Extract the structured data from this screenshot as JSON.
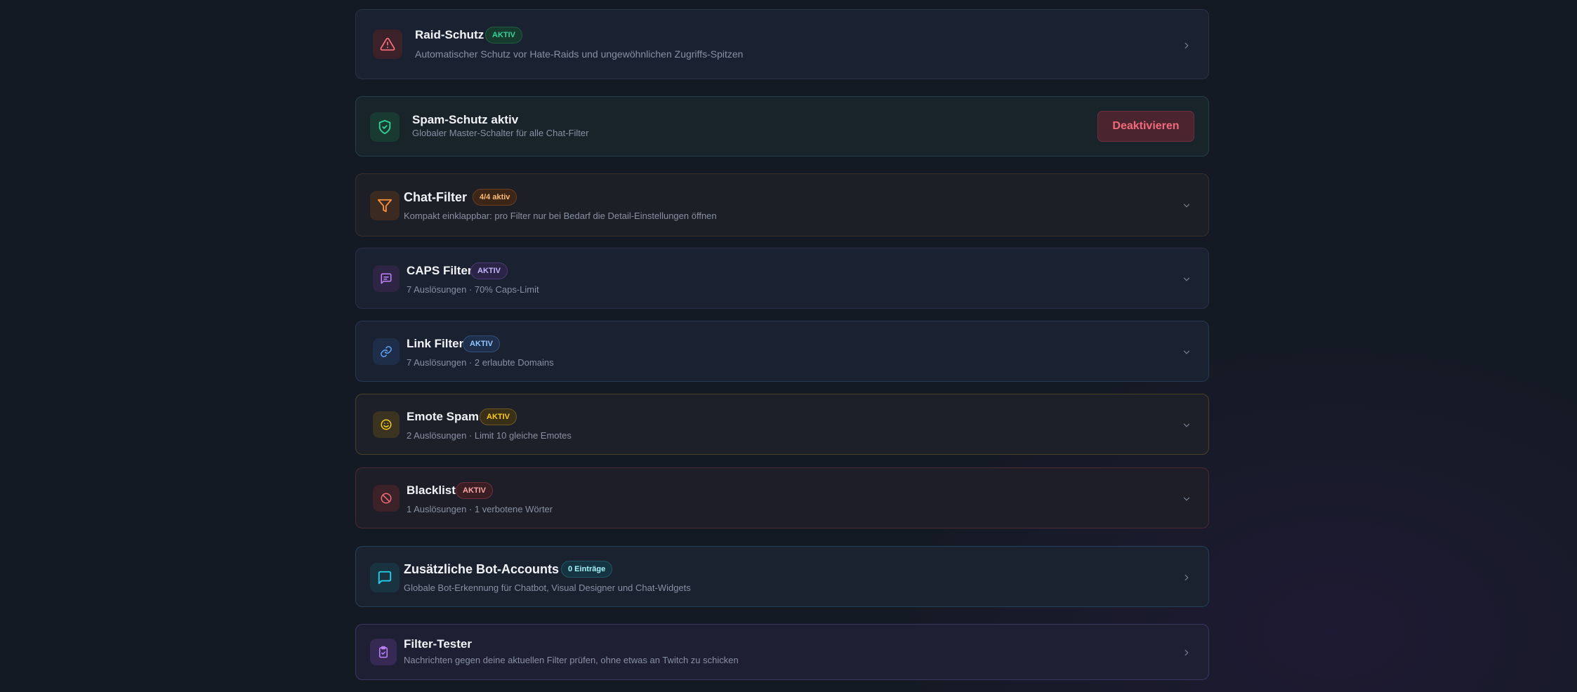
{
  "colors": {
    "red": "#f06a79",
    "green": "#34d399",
    "orange": "#fb923c",
    "purple": "#c084fc",
    "blue": "#60a5fa",
    "yellow": "#facc15",
    "cyan": "#22d3ee"
  },
  "raid": {
    "title": "Raid-Schutz",
    "badge": "AKTIV",
    "subtitle": "Automatischer Schutz vor Hate-Raids und ungewöhnlichen Zugriffs-Spitzen",
    "icon": "warning-triangle-icon"
  },
  "spam": {
    "title": "Spam-Schutz aktiv",
    "subtitle": "Globaler Master-Schalter für alle Chat-Filter",
    "button": "Deaktivieren",
    "icon": "shield-check-icon"
  },
  "chatfilter": {
    "title": "Chat-Filter",
    "badge": "4/4 aktiv",
    "subtitle": "Kompakt einklappbar: pro Filter nur bei Bedarf die Detail-Einstellungen öffnen",
    "icon": "filter-icon"
  },
  "filters": [
    {
      "title": "CAPS Filter",
      "badge": "AKTIV",
      "subtitle": "7 Auslösungen · 70% Caps-Limit",
      "icon": "message-square-icon"
    },
    {
      "title": "Link Filter",
      "badge": "AKTIV",
      "subtitle": "7 Auslösungen · 2 erlaubte Domains",
      "icon": "link-icon"
    },
    {
      "title": "Emote Spam",
      "badge": "AKTIV",
      "subtitle": "2 Auslösungen · Limit 10 gleiche Emotes",
      "icon": "smile-icon"
    },
    {
      "title": "Blacklist",
      "badge": "AKTIV",
      "subtitle": "1 Auslösungen · 1 verbotene Wörter",
      "icon": "ban-icon"
    }
  ],
  "bots": {
    "title": "Zusätzliche Bot-Accounts",
    "badge": "0 Einträge",
    "subtitle": "Globale Bot-Erkennung für Chatbot, Visual Designer und Chat-Widgets",
    "icon": "chat-bubble-icon"
  },
  "tester": {
    "title": "Filter-Tester",
    "subtitle": "Nachrichten gegen deine aktuellen Filter prüfen, ohne etwas an Twitch zu schicken",
    "icon": "clipboard-check-icon"
  }
}
